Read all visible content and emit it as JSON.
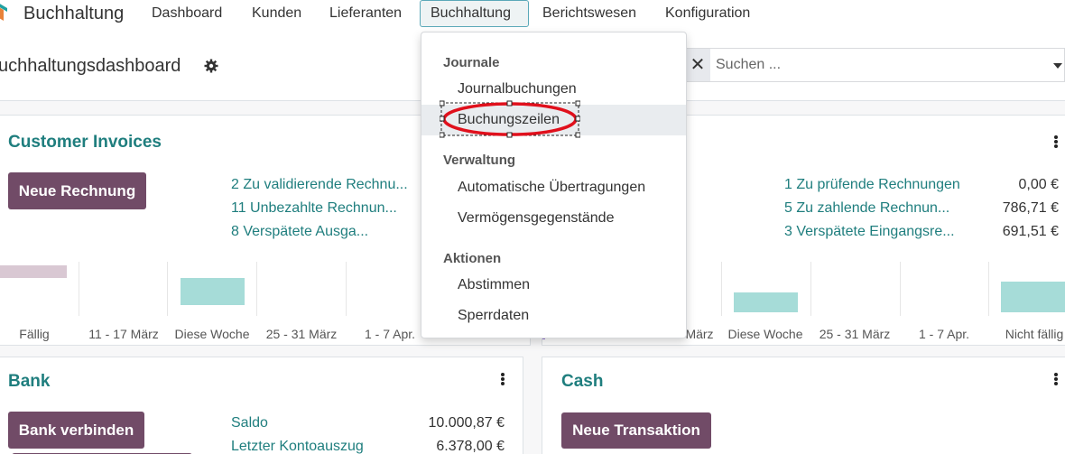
{
  "app": {
    "name": "Buchhaltung"
  },
  "nav": {
    "items": [
      {
        "id": "dashboard",
        "label": "Dashboard"
      },
      {
        "id": "kunden",
        "label": "Kunden"
      },
      {
        "id": "lieferanten",
        "label": "Lieferanten"
      },
      {
        "id": "buchhaltung",
        "label": "Buchhaltung",
        "active": true
      },
      {
        "id": "berichtswesen",
        "label": "Berichtswesen"
      },
      {
        "id": "konfiguration",
        "label": "Konfiguration"
      }
    ]
  },
  "control": {
    "title": "uchhaltungsdashboard",
    "search_facet_remove": "✕",
    "search_placeholder": "Suchen ..."
  },
  "dropdown": {
    "sections": [
      {
        "header": "Journale",
        "items": [
          "Journalbuchungen",
          "Buchungszeilen"
        ]
      },
      {
        "header": "Verwaltung",
        "items": [
          "Automatische Übertragungen",
          "Vermögensgegenstände"
        ]
      },
      {
        "header": "Aktionen",
        "items": [
          "Abstimmen",
          "Sperrdaten"
        ]
      }
    ],
    "highlighted": "Buchungszeilen"
  },
  "cards": {
    "customer_invoices": {
      "title": "Customer Invoices",
      "button": "Neue Rechnung",
      "links": [
        "2 Zu validierende Rechnu...",
        "11 Unbezahlte Rechnun...",
        "8 Verspätete Ausga..."
      ],
      "graph_ticks": [
        "Fällig",
        "11 - 17 März",
        "Diese Woche",
        "25 - 31 März",
        "1 - 7 Apr."
      ]
    },
    "vendor_bills": {
      "links": [
        "1 Zu prüfende Rechnungen",
        "5 Zu zahlende Rechnun...",
        "3 Verspätete Eingangsre..."
      ],
      "amounts": [
        "0,00 €",
        "786,71 €",
        "691,51 €"
      ],
      "graph_ticks": [
        "März",
        "Diese Woche",
        "25 - 31 März",
        "1 - 7 Apr.",
        "Nicht fällig"
      ]
    },
    "bank": {
      "title": "Bank",
      "button": "Bank verbinden",
      "rows": [
        {
          "label": "Saldo",
          "amount": "10.000,87 €"
        },
        {
          "label": "Letzter Kontoauszug",
          "amount": "6.378,00 €"
        }
      ]
    },
    "cash": {
      "title": "Cash",
      "button": "Neue Transaktion"
    }
  },
  "colors": {
    "brand": "#714b67",
    "teal_text": "#1f7e7e",
    "bar_teal": "#a6dcd8",
    "bar_overdue": "#d9c8d3",
    "annotation_red": "#e0101c"
  }
}
